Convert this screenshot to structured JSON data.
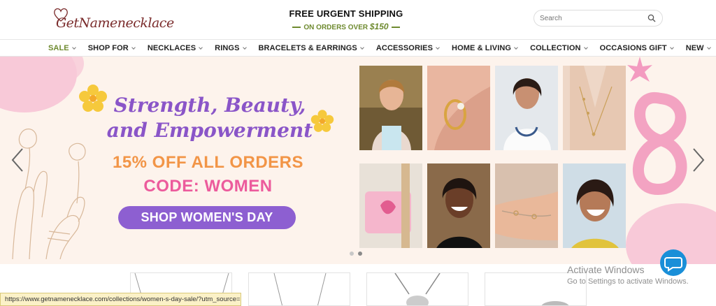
{
  "header": {
    "logo_text": "GetNamenecklace",
    "promo_title": "FREE URGENT SHIPPING",
    "promo_sub_prefix": "ON ORDERS OVER",
    "promo_sub_amount": "$150",
    "search_placeholder": "Search"
  },
  "nav": {
    "items": [
      {
        "label": "SALE",
        "active": true
      },
      {
        "label": "SHOP FOR"
      },
      {
        "label": "NECKLACES"
      },
      {
        "label": "RINGS"
      },
      {
        "label": "BRACELETS & EARRINGS"
      },
      {
        "label": "ACCESSORIES"
      },
      {
        "label": "HOME & LIVING"
      },
      {
        "label": "COLLECTION"
      },
      {
        "label": "OCCASIONS GIFT"
      },
      {
        "label": "NEW"
      }
    ]
  },
  "banner": {
    "headline_line1": "Strength, Beauty,",
    "headline_line2": "and Empowerment",
    "offer": "15% OFF ALL ORDERS",
    "code": "CODE:  WOMEN",
    "cta": "SHOP WOMEN'S DAY",
    "slide_count": 2,
    "active_slide": 2
  },
  "status_bar": {
    "url": "https://www.getnamenecklace.com/collections/women-s-day-sale/?utm_source=..."
  },
  "windows_activation": {
    "title": "Activate Windows",
    "subtitle": "Go to Settings to activate Windows."
  },
  "colors": {
    "accent_green": "#6e8a2f",
    "headline_purple": "#8a55c8",
    "offer_orange": "#f29547",
    "code_pink": "#ec5b9c",
    "cta_purple": "#8d5fd1",
    "banner_bg": "#fdf3ec",
    "chat_blue": "#1a8fd8"
  },
  "icons": {
    "search": "search-icon",
    "prev": "chevron-left-icon",
    "next": "chevron-right-icon",
    "chat": "chat-bubble-icon"
  }
}
